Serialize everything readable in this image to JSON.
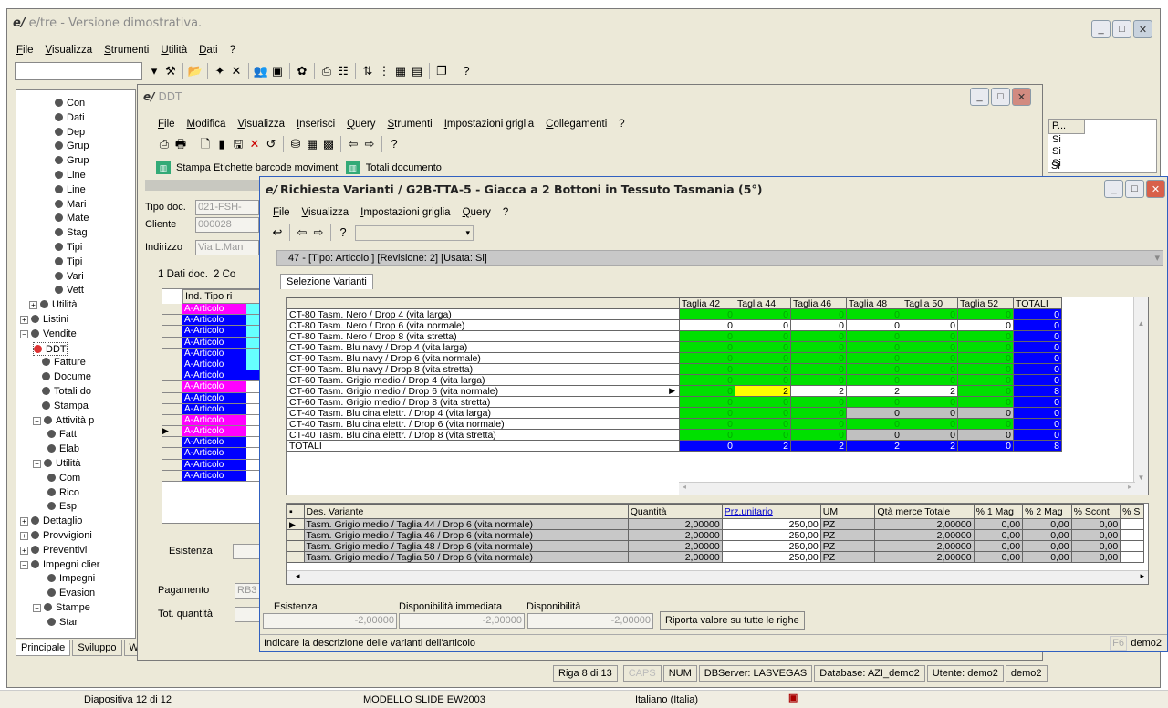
{
  "main_window": {
    "title": "e/tre - Versione dimostrativa.",
    "menu": [
      "File",
      "Visualizza",
      "Strumenti",
      "Utilità",
      "Dati",
      "?"
    ]
  },
  "tree": {
    "items": [
      "Con",
      "Dati",
      "Dep",
      "Grup",
      "Grup",
      "Line",
      "Line",
      "Mari",
      "Mate",
      "Stag",
      "Tipi",
      "Tipi",
      "Vari",
      "Vett",
      "Utilità",
      "Listini",
      "Vendite",
      "DDT",
      "Fatture",
      "Docume",
      "Totali do",
      "Stampa",
      "Attività p",
      "Fatt",
      "Elab",
      "Utilità",
      "Com",
      "Rico",
      "Esp",
      "Dettaglio",
      "Provvigioni",
      "Preventivi",
      "Impegni clier",
      "Impegni",
      "Evasion",
      "Stampe",
      "Star"
    ],
    "tabs": [
      "Principale",
      "Sviluppo",
      "Web"
    ]
  },
  "right_list": {
    "header": "P...",
    "values": [
      "Si",
      "Si",
      "Si",
      "Si"
    ]
  },
  "ddt_window": {
    "title": "DDT",
    "menu": [
      "File",
      "Modifica",
      "Visualizza",
      "Inserisci",
      "Query",
      "Strumenti",
      "Impostazioni griglia",
      "Collegamenti",
      "?"
    ],
    "toolbar2": [
      "Stampa Etichette barcode movimenti",
      "Totali documento"
    ],
    "labels": {
      "tipo_doc": "Tipo doc.",
      "cliente": "Cliente",
      "indirizzo": "Indirizzo",
      "esistenza": "Esistenza",
      "pagamento": "Pagamento",
      "tot_quantita": "Tot. quantità"
    },
    "values": {
      "tipo_doc": "021-FSH-",
      "cliente": "000028",
      "indirizzo": "Via L.Man",
      "pagamento": "RB3"
    },
    "tabs": [
      "1 Dati doc.",
      "2 Co"
    ],
    "grid_header": "Ind. Tipo ri",
    "grid_rows": [
      "A-Articolo",
      "A-Articolo",
      "A-Articolo",
      "A-Articolo",
      "A-Articolo",
      "A-Articolo",
      "A-Articolo",
      "A-Articolo",
      "A-Articolo",
      "A-Articolo",
      "A-Articolo",
      "A-Articolo",
      "A-Articolo",
      "A-Articolo",
      "A-Articolo",
      "A-Articolo"
    ]
  },
  "var_window": {
    "title": "Richiesta Varianti / G2B-TTA-5 - Giacca a 2 Bottoni in Tessuto Tasmania (5°)",
    "menu": [
      "File",
      "Visualizza",
      "Impostazioni griglia",
      "Query",
      "?"
    ],
    "info": "47 - [Tipo: Articolo ] [Revisione: 2] [Usata: Si]",
    "tab": "Selezione Varianti",
    "sizes": [
      "Taglia 42",
      "Taglia 44",
      "Taglia 46",
      "Taglia 48",
      "Taglia 50",
      "Taglia 52",
      "TOTALI"
    ],
    "rows": [
      {
        "name": "CT-80 Tasm. Nero / Drop 4 (vita larga)",
        "vals": [
          "0",
          "0",
          "0",
          "0",
          "0",
          "0",
          "0"
        ],
        "c": [
          "g",
          "g",
          "g",
          "g",
          "g",
          "g",
          "bl"
        ]
      },
      {
        "name": "CT-80 Tasm. Nero / Drop 6 (vita normale)",
        "vals": [
          "0",
          "0",
          "0",
          "0",
          "0",
          "0",
          "0"
        ],
        "c": [
          "w",
          "w",
          "w",
          "w",
          "w",
          "w",
          "bl"
        ]
      },
      {
        "name": "CT-80 Tasm. Nero / Drop 8 (vita stretta)",
        "vals": [
          "0",
          "0",
          "0",
          "0",
          "0",
          "0",
          "0"
        ],
        "c": [
          "g",
          "g",
          "g",
          "g",
          "g",
          "g",
          "bl"
        ]
      },
      {
        "name": "CT-90 Tasm. Blu navy / Drop 4 (vita larga)",
        "vals": [
          "0",
          "0",
          "0",
          "0",
          "0",
          "0",
          "0"
        ],
        "c": [
          "g",
          "g",
          "g",
          "g",
          "g",
          "g",
          "bl"
        ]
      },
      {
        "name": "CT-90 Tasm. Blu navy / Drop 6 (vita normale)",
        "vals": [
          "0",
          "0",
          "0",
          "0",
          "0",
          "0",
          "0"
        ],
        "c": [
          "g",
          "g",
          "g",
          "g",
          "g",
          "g",
          "bl"
        ]
      },
      {
        "name": "CT-90 Tasm. Blu navy / Drop 8 (vita stretta)",
        "vals": [
          "0",
          "0",
          "0",
          "0",
          "0",
          "0",
          "0"
        ],
        "c": [
          "g",
          "g",
          "g",
          "g",
          "g",
          "g",
          "bl"
        ]
      },
      {
        "name": "CT-60 Tasm. Grigio medio / Drop 4 (vita larga)",
        "vals": [
          "0",
          "0",
          "0",
          "0",
          "0",
          "0",
          "0"
        ],
        "c": [
          "g",
          "g",
          "g",
          "g",
          "g",
          "g",
          "bl"
        ]
      },
      {
        "name": "CT-60 Tasm. Grigio medio / Drop 6 (vita normale)",
        "vals": [
          "0",
          "2",
          "2",
          "2",
          "2",
          "0",
          "8"
        ],
        "c": [
          "g",
          "y",
          "w",
          "w",
          "w",
          "g",
          "bl"
        ]
      },
      {
        "name": "CT-60 Tasm. Grigio medio / Drop 8 (vita stretta)",
        "vals": [
          "0",
          "0",
          "0",
          "0",
          "0",
          "0",
          "0"
        ],
        "c": [
          "g",
          "g",
          "g",
          "g",
          "g",
          "g",
          "bl"
        ]
      },
      {
        "name": "CT-40 Tasm. Blu cina elettr. / Drop 4 (vita larga)",
        "vals": [
          "0",
          "0",
          "0",
          "0",
          "0",
          "0",
          "0"
        ],
        "c": [
          "g",
          "g",
          "g",
          "gr",
          "gr",
          "gr",
          "bl"
        ]
      },
      {
        "name": "CT-40 Tasm. Blu cina elettr. / Drop 6 (vita normale)",
        "vals": [
          "0",
          "0",
          "0",
          "0",
          "0",
          "0",
          "0"
        ],
        "c": [
          "g",
          "g",
          "g",
          "g",
          "g",
          "g",
          "bl"
        ]
      },
      {
        "name": "CT-40 Tasm. Blu cina elettr. / Drop 8 (vita stretta)",
        "vals": [
          "0",
          "0",
          "0",
          "0",
          "0",
          "0",
          "0"
        ],
        "c": [
          "g",
          "g",
          "g",
          "gr",
          "gr",
          "gr",
          "bl"
        ]
      }
    ],
    "totals": {
      "label": "TOTALI",
      "vals": [
        "0",
        "2",
        "2",
        "2",
        "2",
        "0",
        "8"
      ]
    },
    "lower_headers": [
      "Des. Variante",
      "Quantità",
      "Prz.unitario",
      "UM",
      "Qtà merce Totale",
      "% 1 Mag",
      "% 2 Mag",
      "% Scont",
      "% S"
    ],
    "lower_rows": [
      [
        "Tasm. Grigio medio / Taglia 44 / Drop 6 (vita normale)",
        "2,00000",
        "250,00",
        "PZ",
        "2,00000",
        "0,00",
        "0,00",
        "0,00"
      ],
      [
        "Tasm. Grigio medio / Taglia 46 / Drop 6 (vita normale)",
        "2,00000",
        "250,00",
        "PZ",
        "2,00000",
        "0,00",
        "0,00",
        "0,00"
      ],
      [
        "Tasm. Grigio medio / Taglia 48 / Drop 6 (vita normale)",
        "2,00000",
        "250,00",
        "PZ",
        "2,00000",
        "0,00",
        "0,00",
        "0,00"
      ],
      [
        "Tasm. Grigio medio / Taglia 50 / Drop 6 (vita normale)",
        "2,00000",
        "250,00",
        "PZ",
        "2,00000",
        "0,00",
        "0,00",
        "0,00"
      ]
    ],
    "bottom_labels": [
      "Esistenza",
      "Disponibilità immediata",
      "Disponibilità"
    ],
    "bottom_values": [
      "-2,00000",
      "-2,00000",
      "-2,00000"
    ],
    "button": "Riporta valore su tutte le righe",
    "hint": "Indicare la descrizione delle varianti dell'articolo",
    "f6": "F6",
    "user": "demo2"
  },
  "statusbar": [
    "Riga 8 di 13",
    "CAPS",
    "NUM",
    "DBServer: LASVEGAS",
    "Database: AZI_demo2",
    "Utente: demo2",
    "demo2"
  ],
  "ppt_status": {
    "slide": "Diapositiva 12 di 12",
    "template": "MODELLO SLIDE EW2003",
    "lang": "Italiano (Italia)"
  },
  "colors": {
    "green": "#00e000",
    "blue": "#0000ff",
    "yellow": "#ffff00",
    "magenta": "#ff00ff",
    "cyan": "#66ffff"
  }
}
